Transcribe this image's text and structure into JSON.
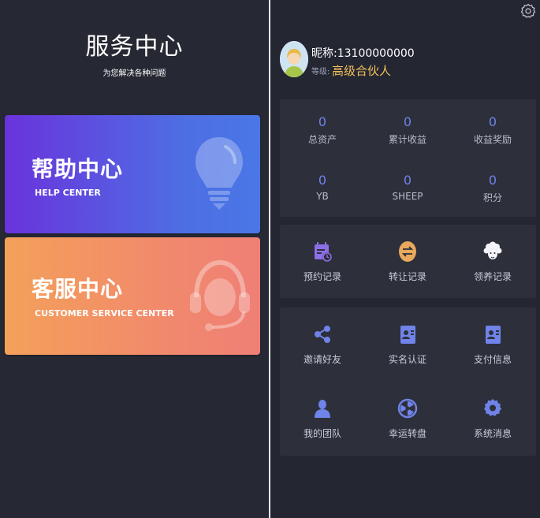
{
  "left": {
    "title": "服务中心",
    "subtitle": "为您解决各种问题",
    "help_card": {
      "title": "帮助中心",
      "subtitle": "HELP CENTER"
    },
    "service_card": {
      "title": "客服中心",
      "subtitle": "CUSTOMER SERVICE CENTER"
    }
  },
  "profile": {
    "nickname": "昵称:13100000000",
    "level_label": "等级:",
    "level_value": "高级合伙人"
  },
  "stats": [
    {
      "value": "0",
      "label": "总资产"
    },
    {
      "value": "0",
      "label": "累计收益"
    },
    {
      "value": "0",
      "label": "收益奖励"
    },
    {
      "value": "0",
      "label": "YB"
    },
    {
      "value": "0",
      "label": "SHEEP"
    },
    {
      "value": "0",
      "label": "积分"
    }
  ],
  "records": [
    {
      "label": "预约记录",
      "icon": "calendar-icon"
    },
    {
      "label": "转让记录",
      "icon": "transfer-icon"
    },
    {
      "label": "领养记录",
      "icon": "sheep-icon"
    }
  ],
  "tools": [
    {
      "label": "邀请好友",
      "icon": "share-icon"
    },
    {
      "label": "实名认证",
      "icon": "id-card-icon"
    },
    {
      "label": "支付信息",
      "icon": "id-card-icon"
    },
    {
      "label": "我的团队",
      "icon": "team-icon"
    },
    {
      "label": "幸运转盘",
      "icon": "wheel-icon"
    },
    {
      "label": "系统消息",
      "icon": "gear-icon"
    }
  ],
  "colors": {
    "background": "#242632",
    "box": "#2d2f3b",
    "accent": "#6f83e8",
    "level": "#f1c059",
    "help_gradient": [
      "#6a33dc",
      "#4977e6"
    ],
    "service_gradient": [
      "#f4a05a",
      "#ef7f76"
    ]
  }
}
